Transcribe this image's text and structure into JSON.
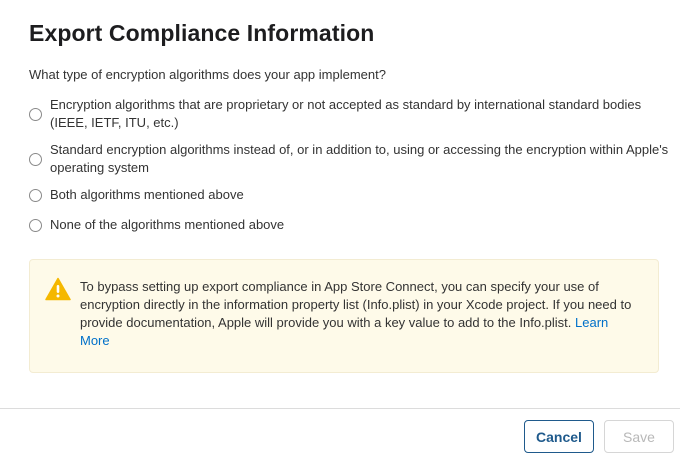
{
  "dialog": {
    "title": "Export Compliance Information",
    "question": "What type of encryption algorithms does your app implement?"
  },
  "options": [
    {
      "label": "Encryption algorithms that are proprietary or not accepted as standard by international standard bodies (IEEE, IETF, ITU, etc.)",
      "selected": false
    },
    {
      "label": "Standard encryption algorithms instead of, or in addition to, using or accessing the encryption within Apple's operating system",
      "selected": false
    },
    {
      "label": "Both algorithms mentioned above",
      "selected": false
    },
    {
      "label": "None of the algorithms mentioned above",
      "selected": false
    }
  ],
  "notice": {
    "icon": "warning-icon",
    "text": "To bypass setting up export compliance in App Store Connect, you can specify your use of encryption directly in the information property list (Info.plist) in your Xcode project. If you need to provide documentation, Apple will provide you with a key value to add to the Info.plist.",
    "link_label": "Learn More",
    "background_color": "#fefae9",
    "icon_color": "#f5b800"
  },
  "footer": {
    "cancel_label": "Cancel",
    "save_label": "Save",
    "accent_color": "#1f5a8c"
  }
}
